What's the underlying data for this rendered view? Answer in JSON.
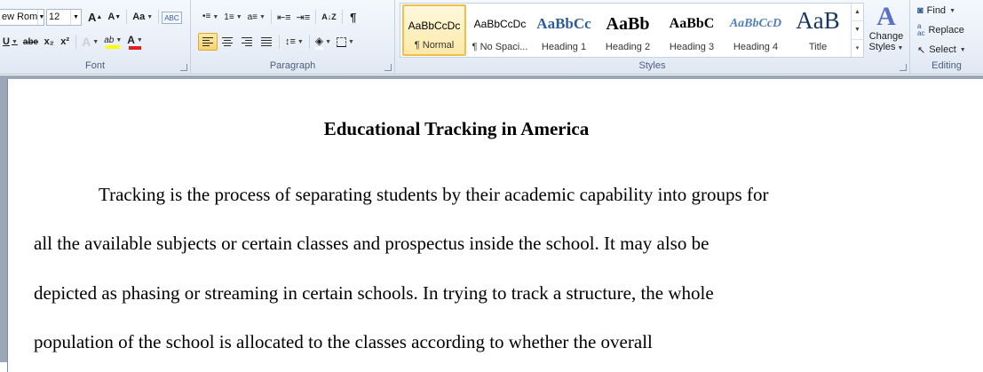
{
  "ribbon": {
    "font": {
      "label": "Font",
      "font_name": "ew Rom",
      "font_size": "12",
      "grow_label": "A",
      "shrink_label": "A",
      "case_label": "Aa",
      "clear_label": "ABC",
      "underline_label": "U",
      "strike_label": "abe",
      "subscript_label": "x₂",
      "superscript_label": "x²",
      "text_effects_label": "A",
      "highlight_label": "ab",
      "font_color_label": "A",
      "highlight_color": "#ffff00",
      "font_color": "#e02020"
    },
    "paragraph": {
      "label": "Paragraph",
      "pilcrow_label": "¶",
      "sort_label": "A↓Z"
    },
    "styles": {
      "label": "Styles",
      "items": [
        {
          "sample": "AaBbCcDc",
          "name": "¶ Normal",
          "selected": true
        },
        {
          "sample": "AaBbCcDc",
          "name": "¶ No Spaci..."
        },
        {
          "sample": "AaBbCc",
          "name": "Heading 1"
        },
        {
          "sample": "AaBb",
          "name": "Heading 2"
        },
        {
          "sample": "AaBbC",
          "name": "Heading 3"
        },
        {
          "sample": "AaBbCcD",
          "name": "Heading 4"
        },
        {
          "sample": "AaB",
          "name": "Title"
        }
      ],
      "change_styles_line1": "Change",
      "change_styles_line2": "Styles"
    },
    "editing": {
      "label": "Editing",
      "find_label": "Find",
      "replace_label": "Replace",
      "select_label": "Select"
    }
  },
  "document": {
    "title": "Educational Tracking in America",
    "lines": [
      "Tracking is the process of separating students by their academic capability into groups for",
      "all the available subjects or certain classes and prospectus inside the school. It may also be",
      "depicted as phasing or streaming in certain schools. In trying to track a structure, the whole",
      "population of the school is allocated to the classes according to whether the overall"
    ]
  }
}
